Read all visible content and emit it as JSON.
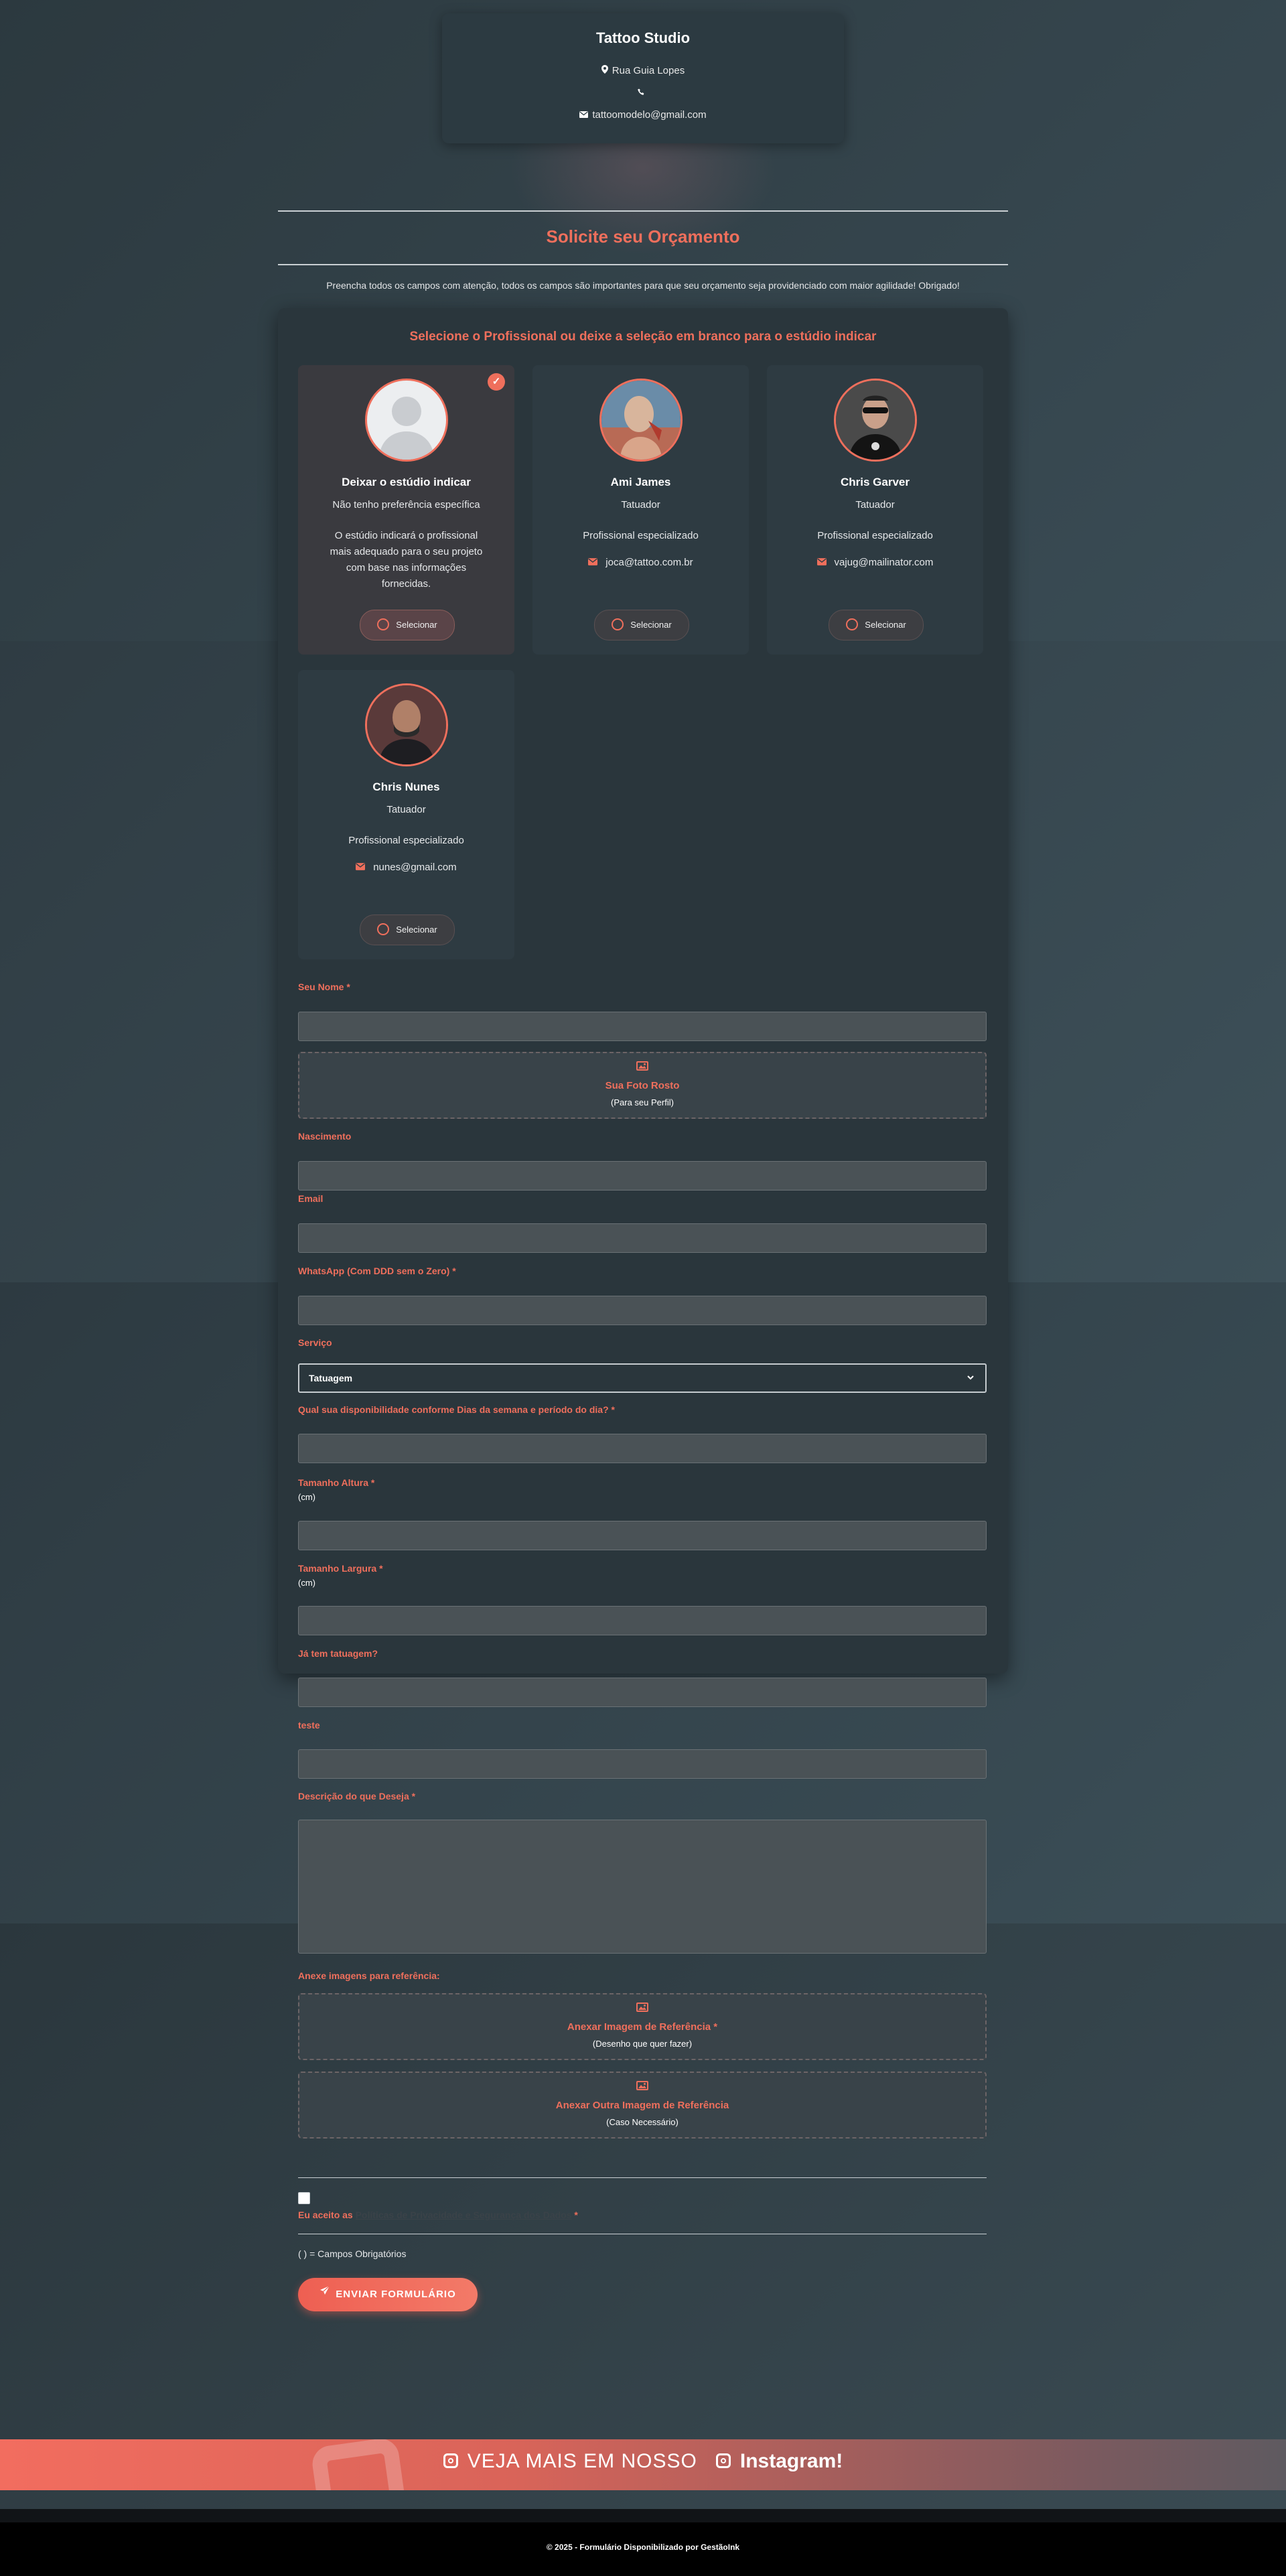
{
  "header": {
    "studio_name": "Tattoo Studio",
    "address": "Rua Guia Lopes",
    "phone": "",
    "email": "tattoomodelo@gmail.com"
  },
  "page": {
    "title": "Solicite seu Orçamento",
    "intro": "Preencha todos os campos com atenção, todos os campos são importantes para que seu orçamento seja providenciado com maior agilidade! Obrigado!"
  },
  "professionals": {
    "heading": "Selecione o Profissional ou deixe a seleção em branco para o estúdio indicar",
    "select_label": "Selecionar",
    "items": [
      {
        "name": "Deixar o estúdio indicar",
        "role": "Não tenho preferência específica",
        "description": "O estúdio indicará o profissional mais adequado para o seu projeto com base nas informações fornecidas.",
        "email": "",
        "selected": true
      },
      {
        "name": "Ami James",
        "role": "Tatuador",
        "description": "Profissional especializado",
        "email": "joca@tattoo.com.br",
        "selected": false
      },
      {
        "name": "Chris Garver",
        "role": "Tatuador",
        "description": "Profissional especializado",
        "email": "vajug@mailinator.com",
        "selected": false
      },
      {
        "name": "Chris Nunes",
        "role": "Tatuador",
        "description": "Profissional especializado",
        "email": "nunes@gmail.com",
        "selected": false
      }
    ]
  },
  "form": {
    "nome_label": "Seu Nome",
    "foto_title": "Sua Foto Rosto",
    "foto_sub": "(Para seu Perfil)",
    "nascimento_label": "Nascimento",
    "email_label": "Email",
    "whatsapp_label": "WhatsApp (Com DDD sem o Zero)",
    "servico_label": "Serviço",
    "servico_value": "Tatuagem",
    "disponibilidade_label": "Qual sua disponibilidade conforme Dias da semana e período do dia?",
    "altura_label": "Tamanho Altura",
    "altura_unit": "(cm)",
    "largura_label": "Tamanho Largura",
    "largura_unit": "(cm)",
    "ja_tem_label": "Já tem tatuagem?",
    "teste_label": "teste",
    "descricao_label": "Descrição do que Deseja",
    "anexe_label": "Anexe imagens para referência:",
    "ref1_title": "Anexar Imagem de Referência",
    "ref1_sub": "(Desenho que quer fazer)",
    "ref2_title": "Anexar Outra Imagem de Referência",
    "ref2_sub": "(Caso Necessário)",
    "accept_prefix": "Eu aceito as",
    "accept_link": "Políticas de Privacidade e Segurança dos Dados",
    "required_note": "(   ) = Campos Obrigatórios",
    "submit_label": "ENVIAR FORMULÁRIO",
    "required_mark": "*"
  },
  "instagram": {
    "prefix": "VEJA MAIS EM NOSSO",
    "brand": "Instagram!"
  },
  "footer": {
    "text": "© 2025 - Formulário Disponibilizado por GestãoInk"
  },
  "colors": {
    "accent": "#ef6f5c",
    "card_bg": "#2a363c",
    "input_bg": "#4a5256",
    "footer_bg": "#000000"
  },
  "icons": [
    "map-marker-icon",
    "phone-icon",
    "envelope-icon",
    "check-icon",
    "image-icon",
    "paper-plane-icon",
    "instagram-icon",
    "chevron-down-icon"
  ]
}
